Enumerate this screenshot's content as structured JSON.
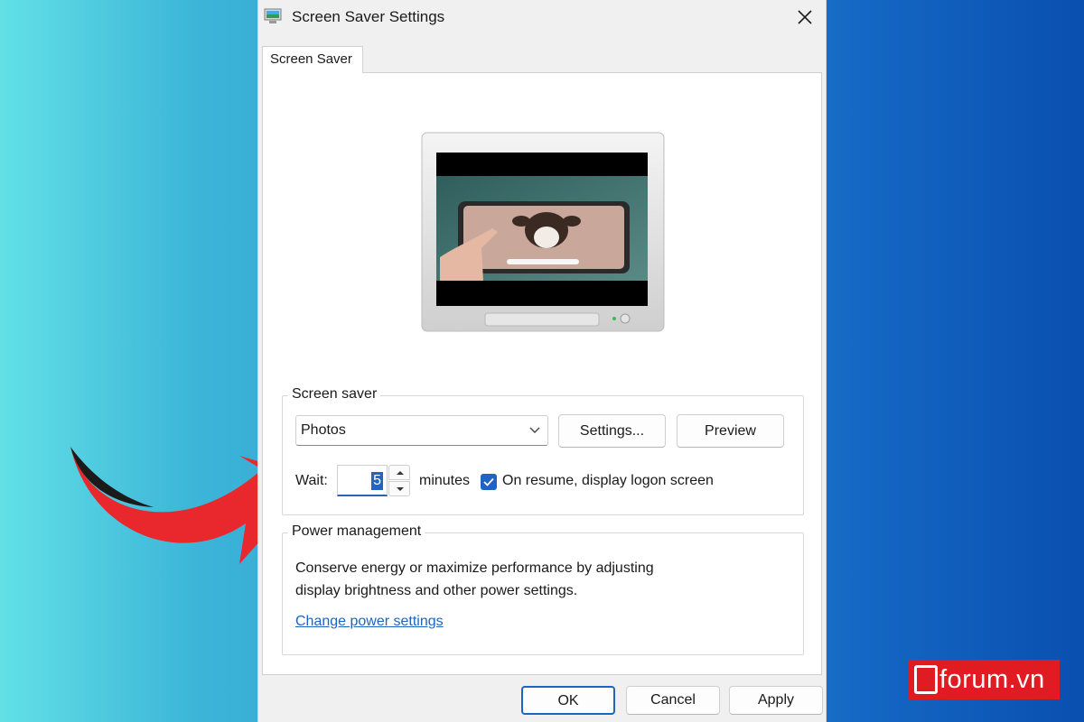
{
  "window": {
    "title": "Screen Saver Settings",
    "app_icon": "screen-saver-icon",
    "close_icon": "close-icon"
  },
  "tabs": [
    {
      "label": "Screen Saver",
      "active": true
    }
  ],
  "preview": {
    "image": "dog-on-tablet-photo",
    "frame": "monitor-icon"
  },
  "screen_saver": {
    "group_label": "Screen saver",
    "selected": "Photos",
    "settings_label": "Settings...",
    "preview_label": "Preview",
    "wait_label": "Wait:",
    "wait_value": "5",
    "minutes_label": "minutes",
    "resume_checked": true,
    "resume_label": "On resume, display logon screen"
  },
  "power": {
    "group_label": "Power management",
    "description_line1": "Conserve energy or maximize performance by adjusting",
    "description_line2": "display brightness and other power settings.",
    "link": "Change power settings"
  },
  "footer": {
    "ok": "OK",
    "cancel": "Cancel",
    "apply": "Apply"
  },
  "watermark": {
    "text": "forum.vn"
  },
  "colors": {
    "accent": "#1f64c0",
    "arrow": "#e8282c",
    "brand": "#e11b22"
  }
}
